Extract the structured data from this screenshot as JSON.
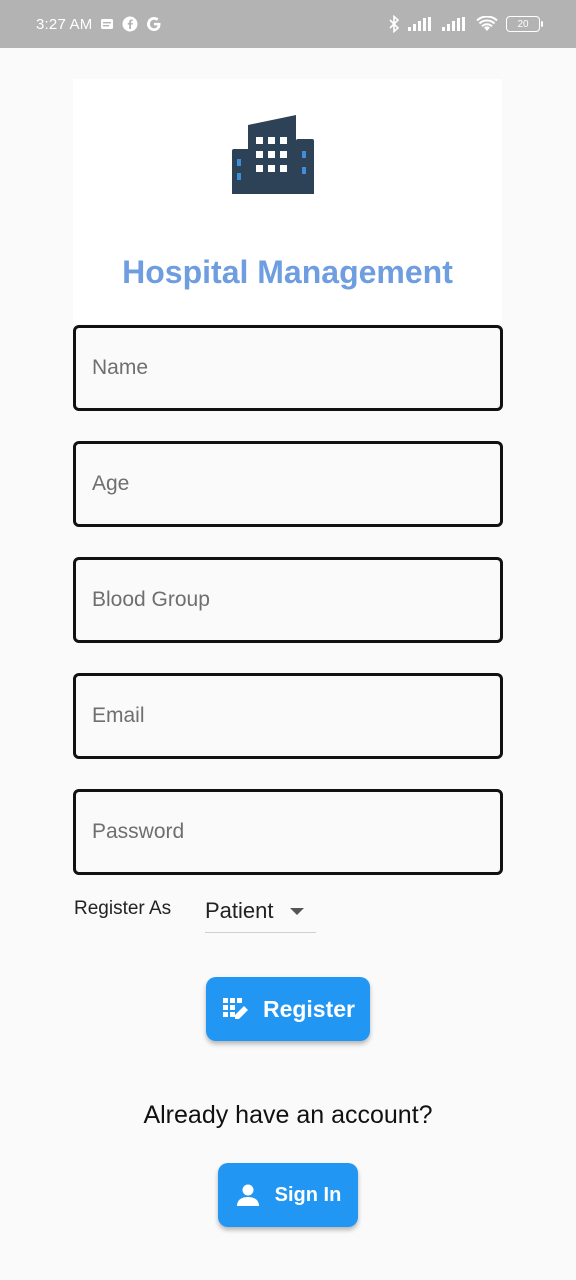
{
  "status_bar": {
    "time": "3:27 AM",
    "battery": "20",
    "left_icons": [
      "notes-icon",
      "facebook-icon",
      "google-icon"
    ],
    "right_icons": [
      "bluetooth-icon",
      "signal-icon",
      "signal-icon",
      "wifi-icon",
      "battery-icon"
    ]
  },
  "header": {
    "title": "Hospital Management",
    "logo_icon": "hospital-building-icon",
    "title_color": "#6e9de0",
    "logo_color": "#2e4257"
  },
  "form": {
    "name_placeholder": "Name",
    "age_placeholder": "Age",
    "blood_group_placeholder": "Blood Group",
    "email_placeholder": "Email",
    "password_placeholder": "Password",
    "register_as_label": "Register As",
    "register_as_value": "Patient"
  },
  "actions": {
    "register_label": "Register",
    "register_icon": "register-icon",
    "already_account_text": "Already have an account?",
    "sign_in_label": "Sign In",
    "sign_in_icon": "person-icon",
    "accent_color": "#2196f3"
  }
}
